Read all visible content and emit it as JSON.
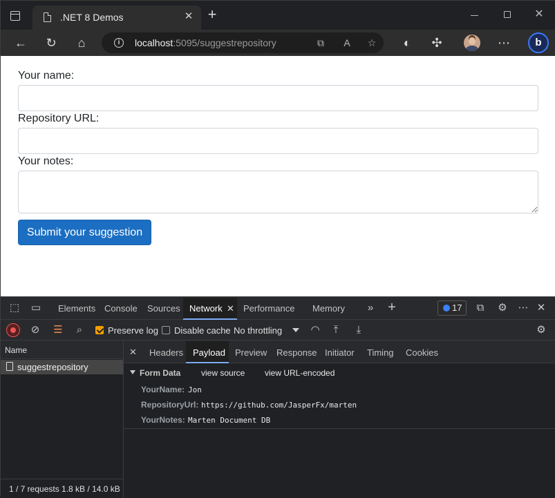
{
  "browser": {
    "tab_title": ".NET 8 Demos",
    "url_host": "localhost",
    "url_rest": ":5095/suggestrepository"
  },
  "form": {
    "name_label": "Your name:",
    "url_label": "Repository URL:",
    "notes_label": "Your notes:",
    "submit_label": "Submit your suggestion"
  },
  "devtools": {
    "tabs": [
      "Elements",
      "Console",
      "Sources",
      "Network",
      "Performance",
      "Memory"
    ],
    "active_tab": "Network",
    "issues_count": "17",
    "preserve_log_label": "Preserve log",
    "preserve_log_checked": true,
    "disable_cache_label": "Disable cache",
    "disable_cache_checked": false,
    "throttling": "No throttling",
    "list_header": "Name",
    "request_name": "suggestrepository",
    "status_summary": "1 / 7 requests  1.8 kB / 14.0 kB",
    "detail_tabs": [
      "Headers",
      "Payload",
      "Preview",
      "Response",
      "Initiator",
      "Timing",
      "Cookies"
    ],
    "active_detail_tab": "Payload",
    "payload": {
      "section_title": "Form Data",
      "view_source": "view source",
      "view_url_encoded": "view URL-encoded",
      "fields": [
        {
          "key": "YourName:",
          "value": "Jon"
        },
        {
          "key": "RepositoryUrl:",
          "value": "https://github.com/JasperFx/marten"
        },
        {
          "key": "YourNotes:",
          "value": "Marten Document DB"
        }
      ]
    }
  },
  "colors": {
    "accent_blue": "#1b6ec2",
    "devtools_active_underline": "#7cacf8",
    "checkbox_orange": "#f4a000",
    "record_red": "#ea5656"
  }
}
